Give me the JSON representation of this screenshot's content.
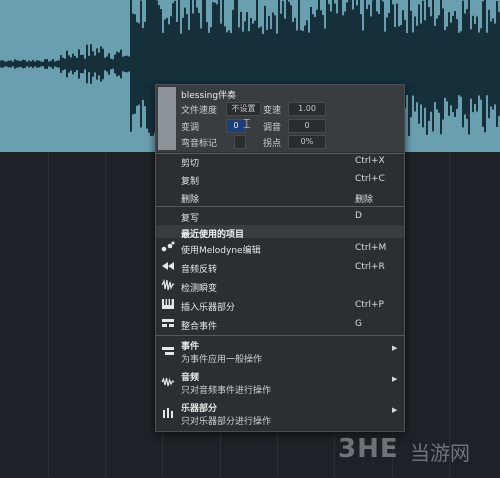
{
  "props_panel": {
    "title": "blessing伴奏",
    "rows": [
      {
        "l1": "文件速度",
        "v1": "不设置",
        "l2": "变速",
        "v2": "1.00"
      },
      {
        "l1": "变调",
        "v1": "0",
        "l2": "调音",
        "v2": "0"
      },
      {
        "l1": "弯音标记",
        "v1": "",
        "l2": "拐点",
        "v2": "0%"
      }
    ]
  },
  "menu": {
    "edit_items": [
      {
        "label": "剪切",
        "shortcut": "Ctrl+X"
      },
      {
        "label": "复制",
        "shortcut": "Ctrl+C"
      },
      {
        "label": "删除",
        "shortcut": "删除"
      }
    ],
    "overwrite": {
      "label": "复写",
      "shortcut": "D"
    },
    "recent_header": "最近使用的项目",
    "recent_items": [
      {
        "label": "使用Melodyne编辑",
        "shortcut": "Ctrl+M",
        "icon": "melodyne-icon"
      },
      {
        "label": "音频反转",
        "shortcut": "Ctrl+R",
        "icon": "reverse-icon"
      },
      {
        "label": "检测瞬变",
        "shortcut": "",
        "icon": "transient-icon"
      },
      {
        "label": "插入乐器部分",
        "shortcut": "Ctrl+P",
        "icon": "piano-icon"
      },
      {
        "label": "整合事件",
        "shortcut": "G",
        "icon": "merge-icon"
      }
    ],
    "submenus": [
      {
        "title": "事件",
        "desc": "为事件应用一般操作",
        "icon": "event-icon"
      },
      {
        "title": "音频",
        "desc": "只对音频事件进行操作",
        "icon": "audio-icon"
      },
      {
        "title": "乐器部分",
        "desc": "只对乐器部分进行操作",
        "icon": "instrument-icon"
      }
    ]
  },
  "watermark": {
    "logo": "3HE",
    "text": "当游网"
  },
  "colors": {
    "track": "#6a9fb0",
    "waveform": "#16303b",
    "menu_bg": "#2c2f32",
    "selected_value": "#1c3f77"
  }
}
